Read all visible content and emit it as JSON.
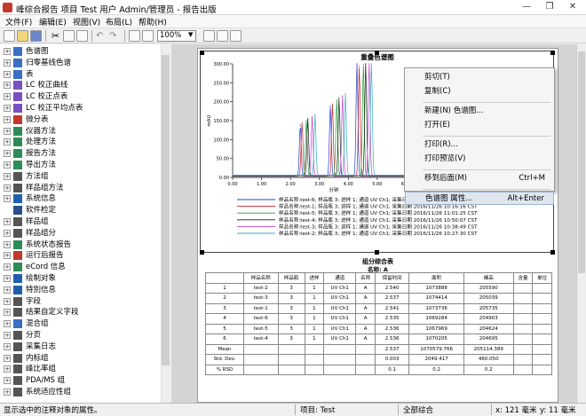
{
  "window": {
    "title": "峰综合报告 项目 Test 用户 Admin/管理员 - 报告出版",
    "controls": [
      "—",
      "❐",
      "✕"
    ]
  },
  "menu": [
    "文件(F)",
    "编辑(E)",
    "视图(V)",
    "布局(L)",
    "帮助(H)"
  ],
  "toolbar": {
    "zoom": "100%"
  },
  "tree": [
    {
      "label": "色谱图",
      "exp": "+",
      "icon": "chromatogram-icon",
      "color": "#3a6fc4"
    },
    {
      "label": "归零基线色谱",
      "exp": "+",
      "icon": "baseline-chromatogram-icon",
      "color": "#3a6fc4"
    },
    {
      "label": "表",
      "exp": "+",
      "icon": "table-icon",
      "color": "#3a6fc4"
    },
    {
      "label": "LC 校正曲线",
      "exp": "+",
      "icon": "calibration-curve-icon",
      "color": "#7a4fbf"
    },
    {
      "label": "LC 校正点表",
      "exp": "+",
      "icon": "calibration-points-icon",
      "color": "#7a4fbf"
    },
    {
      "label": "LC 校正平均点表",
      "exp": "+",
      "icon": "calibration-average-icon",
      "color": "#7a4fbf"
    },
    {
      "label": "微分表",
      "exp": "+",
      "icon": "derivative-table-icon",
      "color": "#c0392b"
    },
    {
      "label": "仪器方法",
      "exp": "+",
      "icon": "instrument-method-icon",
      "color": "#2e8b57"
    },
    {
      "label": "处理方法",
      "exp": "+",
      "icon": "processing-method-icon",
      "color": "#2e8b57"
    },
    {
      "label": "报告方法",
      "exp": "+",
      "icon": "report-method-icon",
      "color": "#2e8b57"
    },
    {
      "label": "导出方法",
      "exp": "+",
      "icon": "export-method-icon",
      "color": "#2e8b57"
    },
    {
      "label": "方法组",
      "exp": "+",
      "icon": "method-set-icon",
      "color": "#555555"
    },
    {
      "label": "样品组方法",
      "exp": "+",
      "icon": "sample-set-method-icon",
      "color": "#555555"
    },
    {
      "label": "系统信息",
      "exp": "+",
      "icon": "system-info-icon",
      "color": "#1f5fb0"
    },
    {
      "label": "软件检定",
      "exp": "",
      "icon": "software-qualification-icon",
      "color": "#2a4f8f"
    },
    {
      "label": "样品组",
      "exp": "+",
      "icon": "sample-set-icon",
      "color": "#555555"
    },
    {
      "label": "样品组分",
      "exp": "+",
      "icon": "sample-component-icon",
      "color": "#555555"
    },
    {
      "label": "系统状态报告",
      "exp": "+",
      "icon": "system-status-icon",
      "color": "#2e8b57"
    },
    {
      "label": "运行后报告",
      "exp": "+",
      "icon": "post-run-report-icon",
      "color": "#c0392b"
    },
    {
      "label": "eCord 信息",
      "exp": "+",
      "icon": "ecord-icon",
      "color": "#2e8b57"
    },
    {
      "label": "绘制对象",
      "exp": "+",
      "icon": "drawing-object-icon",
      "color": "#1f5fb0"
    },
    {
      "label": "特別信息",
      "exp": "+",
      "icon": "special-info-icon",
      "color": "#1f5fb0"
    },
    {
      "label": "字段",
      "exp": "+",
      "icon": "field-icon",
      "color": "#555555"
    },
    {
      "label": "结果自定义字段",
      "exp": "+",
      "icon": "custom-field-icon",
      "color": "#555555"
    },
    {
      "label": "混合组",
      "exp": "+",
      "icon": "mixture-group-icon",
      "color": "#3a6fc4"
    },
    {
      "label": "分页",
      "exp": "+",
      "icon": "page-break-icon",
      "color": "#555555"
    },
    {
      "label": "采集日志",
      "exp": "+",
      "icon": "acquisition-log-icon",
      "color": "#555555"
    },
    {
      "label": "内标组",
      "exp": "+",
      "icon": "internal-standard-icon",
      "color": "#555555"
    },
    {
      "label": "峰比率组",
      "exp": "+",
      "icon": "peak-ratio-icon",
      "color": "#555555"
    },
    {
      "label": "PDA/MS 组",
      "exp": "+",
      "icon": "pda-ms-icon",
      "color": "#555555"
    },
    {
      "label": "系统适应性组",
      "exp": "+",
      "icon": "system-suitability-icon",
      "color": "#555555"
    }
  ],
  "report": {
    "chart_title": "重叠色谱图",
    "table_title": "组分综合表",
    "table_subtitle": "名称: A",
    "legend": [
      "样品名称:test-6; 样品瓶 3; 进样 1; 通道 UV Ch1; 采集日期 2016/11/26 11:12:43 CST",
      "样品名称:test-1; 样品瓶 3; 进样 1; 通道 UV Ch1; 采集日期 2016/11/26 10:16:16 CST",
      "样品名称:test-5; 样品瓶 3; 进样 1; 通道 UV Ch1; 采集日期 2016/11/26 11:01:25 CST",
      "样品名称:test-4; 样品瓶 3; 进样 1; 通道 UV Ch1; 采集日期 2016/11/26 10:50:07 CST",
      "样品名称:test-3; 样品瓶 3; 进样 1; 通道 UV Ch1; 采集日期 2016/11/26 10:38:49 CST",
      "样品名称:test-2; 样品瓶 3; 进样 1; 通道 UV Ch1; 采集日期 2016/11/26 10:27:30 CST"
    ],
    "table_headers": [
      "",
      "样品名称",
      "样品瓶",
      "进样",
      "通道",
      "名称",
      "保留时间",
      "面积",
      "峰高",
      "含量",
      "单位"
    ],
    "table_rows": [
      [
        "1",
        "test-2",
        "3",
        "1",
        "UV Ch1",
        "A",
        "2.540",
        "1073888",
        "205590",
        "",
        ""
      ],
      [
        "2",
        "test-3",
        "3",
        "1",
        "UV Ch1",
        "A",
        "2.537",
        "1074414",
        "205039",
        "",
        ""
      ],
      [
        "3",
        "test-1",
        "3",
        "1",
        "UV Ch1",
        "A",
        "2.541",
        "1073736",
        "205735",
        "",
        ""
      ],
      [
        "4",
        "test-6",
        "3",
        "1",
        "UV Ch1",
        "A",
        "2.535",
        "1069284",
        "204903",
        "",
        ""
      ],
      [
        "5",
        "test-5",
        "3",
        "1",
        "UV Ch1",
        "A",
        "2.536",
        "1067969",
        "204624",
        "",
        ""
      ],
      [
        "6",
        "test-4",
        "3",
        "1",
        "UV Ch1",
        "A",
        "2.536",
        "1070205",
        "204695",
        "",
        ""
      ]
    ],
    "table_stats": [
      [
        "Mean",
        "",
        "",
        "",
        "",
        "",
        "2.537",
        "1070579.766",
        "205114.389",
        "",
        ""
      ],
      [
        "Std. Dev.",
        "",
        "",
        "",
        "",
        "",
        "0.003",
        "2049.417",
        "460.050",
        "",
        ""
      ],
      [
        "% RSD",
        "",
        "",
        "",
        "",
        "",
        "0.1",
        "0.2",
        "0.2",
        "",
        ""
      ]
    ]
  },
  "chart_data": {
    "type": "line",
    "title": "重叠色谱图",
    "xlabel": "分钟",
    "ylabel": "mAU",
    "xlim": [
      0.0,
      7.0
    ],
    "ylim": [
      0,
      300
    ],
    "x_ticks": [
      "0.00",
      "1.00",
      "2.00",
      "3.00",
      "4.00",
      "5.00",
      "6.00",
      "7.00"
    ],
    "y_ticks": [
      "0.00",
      "50.00",
      "100.00",
      "150.00",
      "200.00",
      "250.00",
      "300.00"
    ],
    "series": [
      {
        "name": "test-6",
        "color": "#1f3fd0",
        "peaks": [
          [
            2.34,
            135
          ],
          [
            3.38,
            185
          ],
          [
            4.3,
            300
          ]
        ]
      },
      {
        "name": "test-1",
        "color": "#cf2020",
        "peaks": [
          [
            2.4,
            140
          ],
          [
            3.45,
            190
          ],
          [
            4.38,
            290
          ]
        ]
      },
      {
        "name": "test-5",
        "color": "#22a03a",
        "peaks": [
          [
            2.55,
            145
          ],
          [
            3.6,
            200
          ],
          [
            4.52,
            295
          ]
        ]
      },
      {
        "name": "test-4",
        "color": "#1c1c1c",
        "peaks": [
          [
            2.6,
            150
          ],
          [
            3.68,
            205
          ],
          [
            4.6,
            300
          ]
        ]
      },
      {
        "name": "test-3",
        "color": "#c040d0",
        "peaks": [
          [
            2.75,
            155
          ],
          [
            3.8,
            210
          ],
          [
            4.72,
            300
          ]
        ]
      },
      {
        "name": "test-2",
        "color": "#30b0c0",
        "peaks": [
          [
            2.85,
            160
          ],
          [
            3.9,
            215
          ],
          [
            4.8,
            300
          ]
        ]
      }
    ]
  },
  "context_menu": [
    {
      "label": "剪切(T)",
      "shortcut": ""
    },
    {
      "label": "复制(C)",
      "shortcut": ""
    },
    {
      "sep": true
    },
    {
      "label": "新建(N) 色谱图...",
      "shortcut": ""
    },
    {
      "label": "打开(E)",
      "shortcut": ""
    },
    {
      "sep": true
    },
    {
      "label": "打印(R)...",
      "shortcut": ""
    },
    {
      "label": "打印预览(V)",
      "shortcut": ""
    },
    {
      "sep": true
    },
    {
      "label": "移到后面(M)",
      "shortcut": "Ctrl+M"
    },
    {
      "sep": true
    },
    {
      "label": "色谱图 属性...",
      "shortcut": "Alt+Enter"
    }
  ],
  "status": {
    "hint": "显示选中的注释对象的属性。",
    "project": "项目: Test",
    "scope": "全部综合",
    "x": "x: 121 毫米",
    "y": "y: 11 毫米"
  }
}
